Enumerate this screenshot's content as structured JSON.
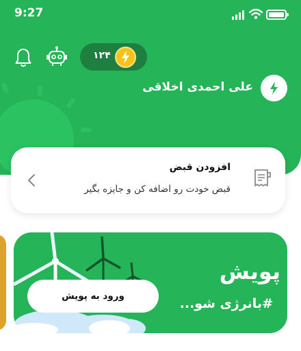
{
  "status_bar": {
    "time": "9:27"
  },
  "header": {
    "points": "۱۲۴",
    "user_name": "علی احمدی اخلاقی",
    "colors": {
      "background": "#25b457",
      "points_pill": "#1e7f40",
      "coin": "#f6c31a"
    }
  },
  "icons": [
    "bell-icon",
    "robot-icon",
    "lightning-coin-icon",
    "lightning-badge-icon",
    "bill-icon",
    "chevron-left-icon",
    "signal-icon",
    "wifi-icon",
    "battery-icon"
  ],
  "bill_card": {
    "title": "افزودن قبض",
    "subtitle": "قبض خودت رو اضافه کن و جایزه بگیر"
  },
  "banner": {
    "title": "پویش",
    "hashtag": "#بانرژی شو...",
    "button_label": "ورود به پویش",
    "color": "#25b457"
  }
}
